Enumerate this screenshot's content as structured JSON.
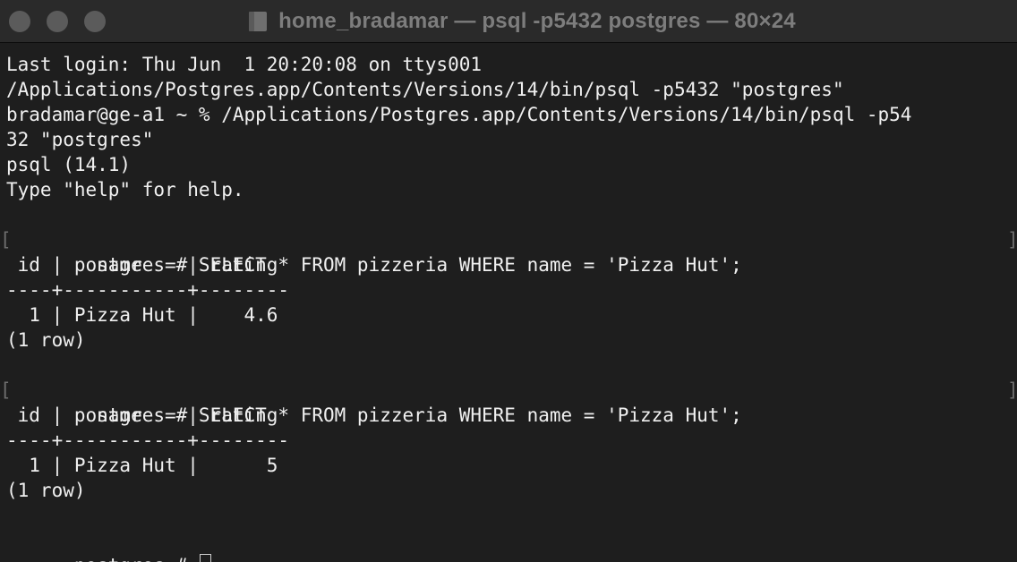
{
  "window": {
    "title": "home_bradamar — psql -p5432 postgres — 80×24"
  },
  "terminal": {
    "lines": [
      "Last login: Thu Jun  1 20:20:08 on ttys001",
      "/Applications/Postgres.app/Contents/Versions/14/bin/psql -p5432 \"postgres\"",
      "bradamar@ge-a1 ~ % /Applications/Postgres.app/Contents/Versions/14/bin/psql -p54",
      "32 \"postgres\"",
      "psql (14.1)",
      "Type \"help\" for help.",
      "",
      "postgres=# SELECT * FROM pizzeria WHERE name = 'Pizza Hut';",
      " id |   name    | rating",
      "----+-----------+--------",
      "  1 | Pizza Hut |    4.6",
      "(1 row)",
      "",
      "postgres=# SELECT * FROM pizzeria WHERE name = 'Pizza Hut';",
      " id |   name    | rating",
      "----+-----------+--------",
      "  1 | Pizza Hut |      5",
      "(1 row)",
      "",
      "postgres=# "
    ],
    "mark_left": "[",
    "mark_right": "]"
  },
  "colors": {
    "background": "#1e1e1e",
    "titlebar": "#2a2a2a",
    "text": "#f0f0f0",
    "title_text": "#7d7d7d"
  }
}
